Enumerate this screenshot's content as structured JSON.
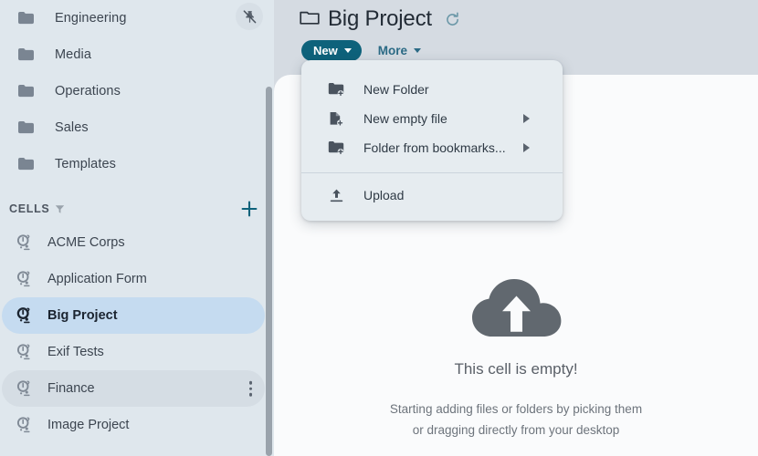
{
  "sidebar": {
    "pin_button": {
      "icon": "pin-off-icon",
      "title": "Unpin"
    },
    "folders": [
      {
        "icon": "folder-icon",
        "label": "Engineering"
      },
      {
        "icon": "folder-icon",
        "label": "Media"
      },
      {
        "icon": "folder-icon",
        "label": "Operations"
      },
      {
        "icon": "folder-icon",
        "label": "Sales"
      },
      {
        "icon": "folder-icon",
        "label": "Templates"
      }
    ],
    "section": {
      "title": "CELLS",
      "filter_icon": "filter-funnel-icon",
      "add_icon": "plus-icon",
      "add_color": "#0e627b"
    },
    "cells": [
      {
        "icon": "cell-icon",
        "label": "ACME Corps",
        "state": "normal"
      },
      {
        "icon": "cell-icon",
        "label": "Application Form",
        "state": "normal"
      },
      {
        "icon": "cell-icon",
        "label": "Big Project",
        "state": "selected"
      },
      {
        "icon": "cell-icon",
        "label": "Exif Tests",
        "state": "normal"
      },
      {
        "icon": "cell-icon",
        "label": "Finance",
        "state": "hovered",
        "kebab": "more-options-icon"
      },
      {
        "icon": "cell-icon",
        "label": "Image Project",
        "state": "normal"
      }
    ],
    "colors": {
      "background": "#dfe7ed",
      "selected": "#c5dbf0",
      "hovered": "#d5dde4",
      "scrollbar": "#9aa3ac"
    }
  },
  "header": {
    "folder_icon": "folder-outline-icon",
    "title": "Big Project",
    "refresh_icon": "refresh-icon",
    "toolbar": {
      "new_label": "New",
      "new_caret": "caret-down-icon",
      "more_label": "More",
      "more_caret": "caret-down-icon",
      "new_bg": "#0e627b",
      "more_color": "#2b6a85"
    }
  },
  "menu": {
    "items": [
      {
        "icon": "new-folder-icon",
        "label": "New Folder",
        "submenu": false
      },
      {
        "icon": "new-file-icon",
        "label": "New empty file",
        "submenu": true
      },
      {
        "icon": "folder-bookmark-icon",
        "label": "Folder from bookmarks...",
        "submenu": true
      }
    ],
    "upload": {
      "icon": "upload-icon",
      "label": "Upload",
      "submenu": false
    }
  },
  "empty_state": {
    "icon": "cloud-upload-icon",
    "title": "This cell is empty!",
    "line1": "Starting adding files or folders by picking them",
    "line2": "or dragging directly from your desktop"
  }
}
